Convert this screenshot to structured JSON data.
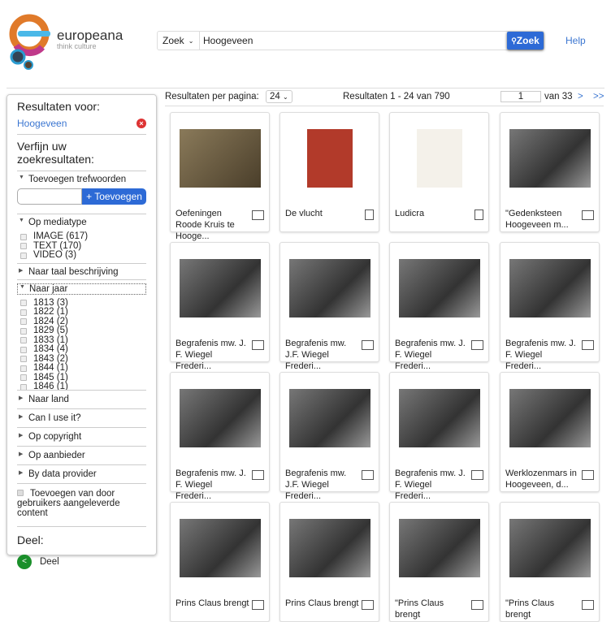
{
  "header": {
    "brand": "europeana",
    "tagline": "think culture",
    "search_scope": "Zoek",
    "search_value": "Hoogeveen",
    "search_button": "Zoek",
    "help": "Help"
  },
  "sidebar": {
    "results_for": "Resultaten voor:",
    "query": "Hoogeveen",
    "refine": "Verfijn uw zoekresultaten:",
    "keywords": {
      "label": "Toevoegen trefwoorden",
      "button": "+ Toevoegen"
    },
    "mediatype": {
      "label": "Op mediatype",
      "options": [
        "IMAGE (617)",
        "TEXT (170)",
        "VIDEO (3)"
      ]
    },
    "language": "Naar taal beschrijving",
    "year": {
      "label": "Naar jaar",
      "options": [
        "1813 (3)",
        "1822 (1)",
        "1824 (2)",
        "1829 (5)",
        "1833 (1)",
        "1834 (4)",
        "1843 (2)",
        "1844 (1)",
        "1845 (1)",
        "1846 (1)"
      ]
    },
    "collapsed": [
      "Naar land",
      "Can I use it?",
      "Op copyright",
      "Op aanbieder",
      "By data provider"
    ],
    "ugc": "Toevoegen van door gebruikers aangeleverde content",
    "share_title": "Deel:",
    "share": "Deel"
  },
  "results_bar": {
    "per_page_label": "Resultaten per pagina:",
    "per_page": "24",
    "summary": "Resultaten  1 - 24 van 790",
    "page": "1",
    "of": "van 33",
    "next": ">",
    "last": ">>"
  },
  "results": [
    {
      "title": "Oefeningen Roode Kruis te Hooge...",
      "type": "image"
    },
    {
      "title": "De vlucht",
      "type": "text"
    },
    {
      "title": "Ludicra",
      "type": "text"
    },
    {
      "title": "\"Gedenksteen Hoogeveen m...",
      "type": "image"
    },
    {
      "title": "Begrafenis mw. J. F. Wiegel Frederi...",
      "type": "image"
    },
    {
      "title": "Begrafenis mw. J.F. Wiegel Frederi...",
      "type": "image"
    },
    {
      "title": "Begrafenis mw. J. F. Wiegel Frederi...",
      "type": "image"
    },
    {
      "title": "Begrafenis mw. J. F. Wiegel Frederi...",
      "type": "image"
    },
    {
      "title": "Begrafenis mw. J. F. Wiegel Frederi...",
      "type": "image"
    },
    {
      "title": "Begrafenis mw. J.F. Wiegel Frederi...",
      "type": "image"
    },
    {
      "title": "Begrafenis mw. J. F. Wiegel Frederi...",
      "type": "image"
    },
    {
      "title": "Werklozenmars in Hoogeveen, d...",
      "type": "image"
    },
    {
      "title": "Prins Claus brengt",
      "type": "image"
    },
    {
      "title": "Prins Claus brengt",
      "type": "image"
    },
    {
      "title": "\"Prins Claus brengt",
      "type": "image"
    },
    {
      "title": "\"Prins Claus brengt",
      "type": "image"
    }
  ]
}
